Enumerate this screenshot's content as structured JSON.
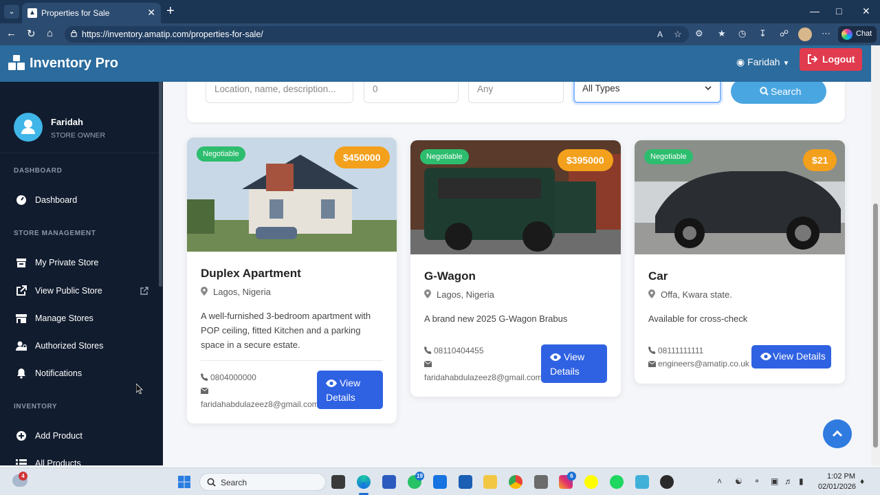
{
  "browser": {
    "tab_title": "Properties for Sale",
    "url": "https://inventory.amatip.com/properties-for-sale/",
    "chat_label": "Chat"
  },
  "navbar": {
    "brand": "Inventory Pro",
    "user": "Faridah",
    "logout": "Logout"
  },
  "sidebar": {
    "profile_name": "Faridah",
    "profile_role": "STORE OWNER",
    "sections": {
      "dashboard": "DASHBOARD",
      "store_management": "STORE MANAGEMENT",
      "inventory": "INVENTORY"
    },
    "items": {
      "dashboard": "Dashboard",
      "my_private_store": "My Private Store",
      "view_public_store": "View Public Store",
      "manage_stores": "Manage Stores",
      "authorized_stores": "Authorized Stores",
      "notifications": "Notifications",
      "add_product": "Add Product",
      "all_products": "All Products"
    }
  },
  "search": {
    "keyword_placeholder": "Location, name, description...",
    "min_value": "0",
    "max_value": "Any",
    "type_selected": "All Types",
    "button": "Search"
  },
  "cards": [
    {
      "badge": "Negotiable",
      "price": "$450000",
      "title": "Duplex Apartment",
      "location": "Lagos, Nigeria",
      "description": "A well-furnished 3-bedroom apartment with POP ceiling, fitted Kitchen and a parking space in a secure estate.",
      "phone": "0804000000",
      "email": "faridahabdulazeez8@gmail.com",
      "button_line1": "View",
      "button_line2": "Details"
    },
    {
      "badge": "Negotiable",
      "price": "$395000",
      "title": "G-Wagon",
      "location": "Lagos, Nigeria",
      "description": "A brand new 2025 G-Wagon Brabus",
      "phone": "08110404455",
      "email": "faridahabdulazeez8@gmail.com",
      "button_line1": "View",
      "button_line2": "Details"
    },
    {
      "badge": "Negotiable",
      "price": "$21",
      "title": "Car",
      "location": "Offa, Kwara state.",
      "description": "Available for cross-check",
      "phone": "08111111111",
      "email": "engineers@amatip.co.uk",
      "button_label": "View Details"
    }
  ],
  "taskbar": {
    "search_label": "Search",
    "time": "1:02 PM",
    "date": "02/01/2026",
    "weather_badge": "4",
    "whatsapp_badge": "19",
    "instagram_badge": "6"
  }
}
